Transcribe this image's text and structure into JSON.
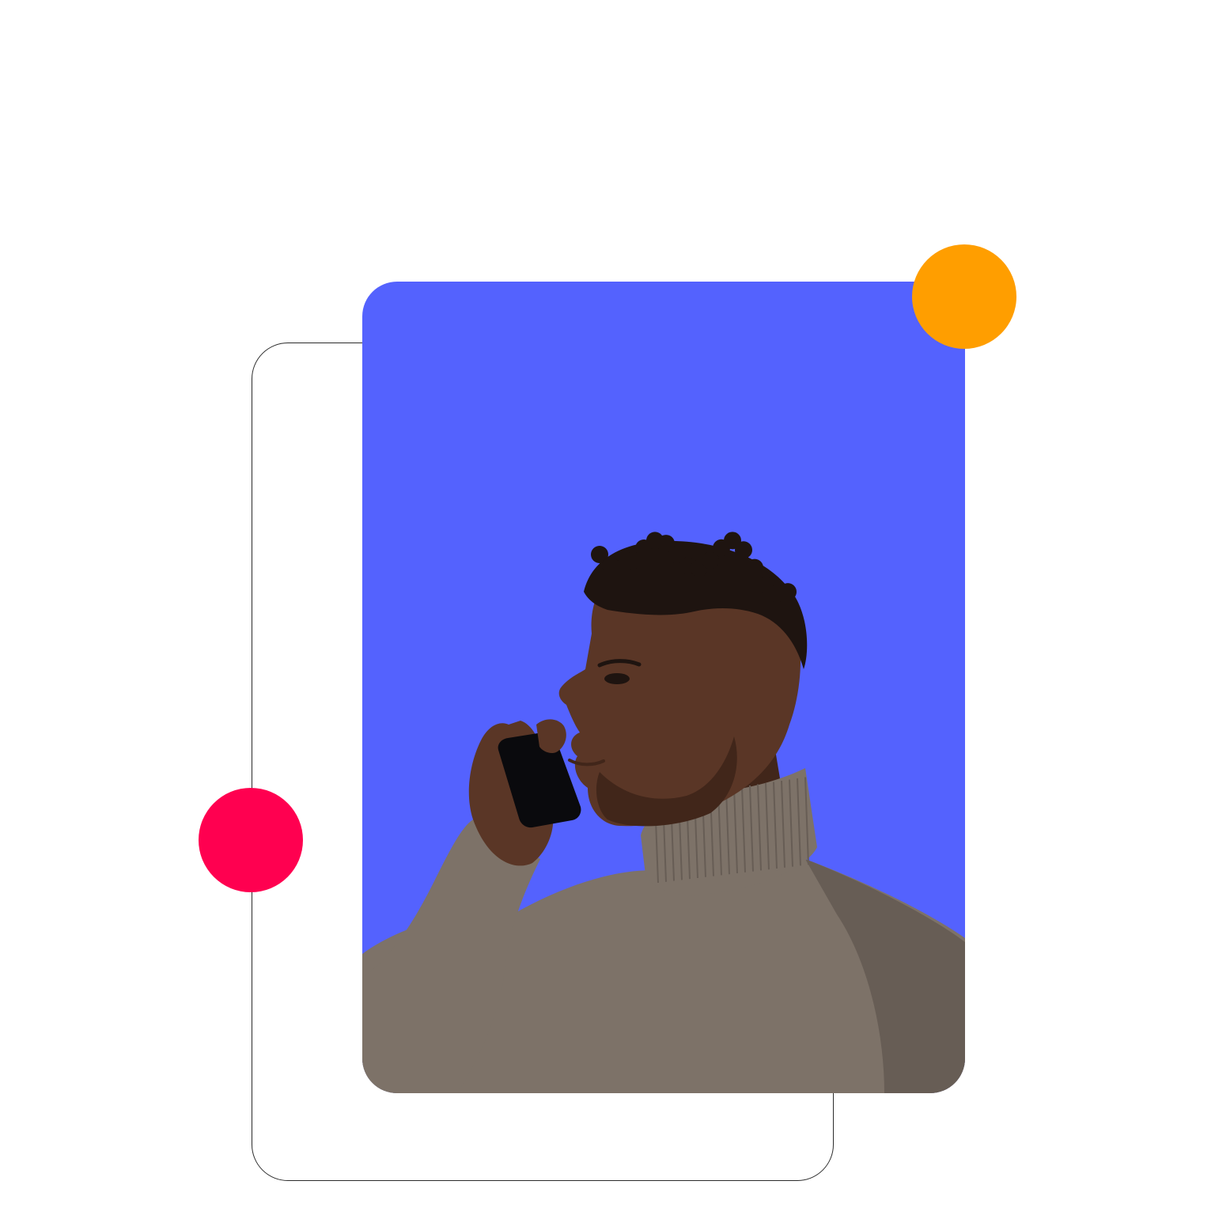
{
  "colors": {
    "card_background": "#5462FE",
    "orange_dot": "#FF9E00",
    "red_dot": "#FF0050",
    "frame_stroke": "#2B2B2B",
    "sweater": "#7D7268",
    "sweater_shadow": "#675D55",
    "skin": "#5A3626",
    "skin_shadow": "#41261A",
    "hair": "#1E1410",
    "phone": "#0A0A0D"
  },
  "illustration": {
    "subject": "person-on-phone-icon"
  }
}
